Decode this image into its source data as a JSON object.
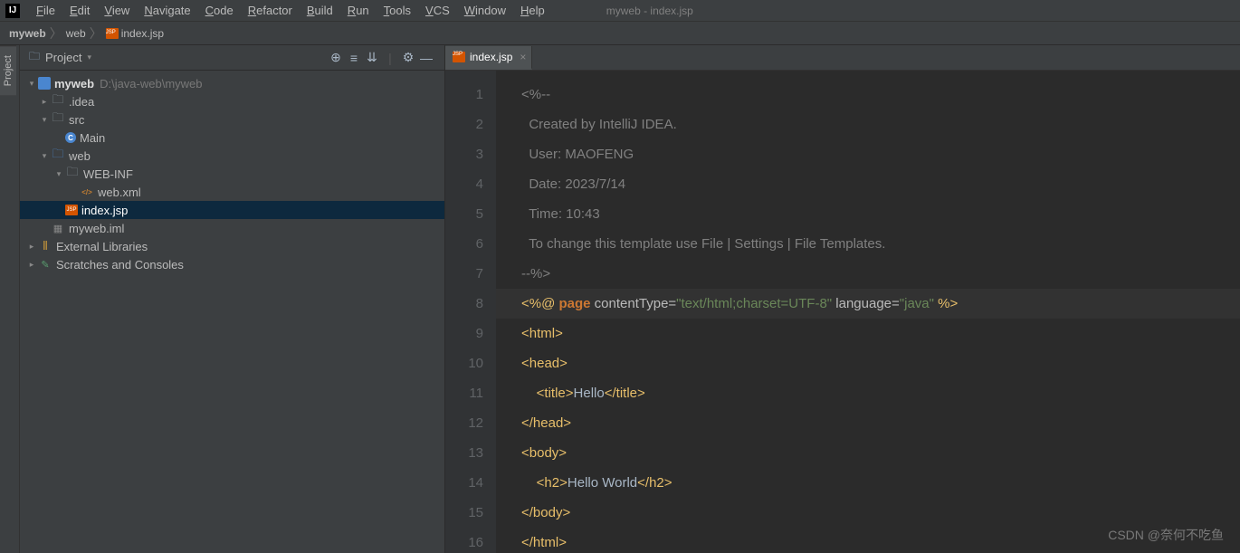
{
  "window": {
    "title": "myweb - index.jsp"
  },
  "menubar": [
    "File",
    "Edit",
    "View",
    "Navigate",
    "Code",
    "Refactor",
    "Build",
    "Run",
    "Tools",
    "VCS",
    "Window",
    "Help"
  ],
  "breadcrumbs": [
    {
      "label": "myweb",
      "bold": true
    },
    {
      "label": "web",
      "bold": false
    },
    {
      "label": "index.jsp",
      "bold": false,
      "icon": "jsp"
    }
  ],
  "project_pane": {
    "title": "Project",
    "tree": [
      {
        "depth": 0,
        "arrow": "down",
        "icon": "module",
        "label": "myweb",
        "suffix": "D:\\java-web\\myweb"
      },
      {
        "depth": 1,
        "arrow": "right",
        "icon": "folder",
        "label": ".idea"
      },
      {
        "depth": 1,
        "arrow": "down",
        "icon": "folder",
        "label": "src"
      },
      {
        "depth": 2,
        "arrow": "none",
        "icon": "class",
        "label": "Main"
      },
      {
        "depth": 1,
        "arrow": "down",
        "icon": "webfolder",
        "label": "web"
      },
      {
        "depth": 2,
        "arrow": "down",
        "icon": "folder",
        "label": "WEB-INF"
      },
      {
        "depth": 3,
        "arrow": "none",
        "icon": "xml",
        "label": "web.xml"
      },
      {
        "depth": 2,
        "arrow": "none",
        "icon": "jsp",
        "label": "index.jsp",
        "selected": true
      },
      {
        "depth": 1,
        "arrow": "none",
        "icon": "iml",
        "label": "myweb.iml"
      },
      {
        "depth": 0,
        "arrow": "right",
        "icon": "lib",
        "label": "External Libraries"
      },
      {
        "depth": 0,
        "arrow": "right",
        "icon": "scratch",
        "label": "Scratches and Consoles"
      }
    ]
  },
  "side_tab": "Project",
  "editor": {
    "tab": {
      "label": "index.jsp",
      "icon": "jsp"
    },
    "lines": [
      {
        "n": 1,
        "segments": [
          {
            "t": "<%--",
            "c": "comment"
          }
        ]
      },
      {
        "n": 2,
        "segments": [
          {
            "t": "  Created by IntelliJ IDEA.",
            "c": "comment"
          }
        ]
      },
      {
        "n": 3,
        "segments": [
          {
            "t": "  User: MAOFENG",
            "c": "comment"
          }
        ]
      },
      {
        "n": 4,
        "segments": [
          {
            "t": "  Date: 2023/7/14",
            "c": "comment"
          }
        ]
      },
      {
        "n": 5,
        "segments": [
          {
            "t": "  Time: 10:43",
            "c": "comment"
          }
        ]
      },
      {
        "n": 6,
        "segments": [
          {
            "t": "  To change this template use File | Settings | File Templates.",
            "c": "comment"
          }
        ]
      },
      {
        "n": 7,
        "segments": [
          {
            "t": "--%>",
            "c": "comment"
          }
        ]
      },
      {
        "n": 8,
        "hl": true,
        "segments": [
          {
            "t": "<%@ ",
            "c": "tag"
          },
          {
            "t": "page",
            "c": "kw"
          },
          {
            "t": " contentType=",
            "c": "attr"
          },
          {
            "t": "\"text/html;charset=UTF-8\"",
            "c": "str"
          },
          {
            "t": " language=",
            "c": "attr"
          },
          {
            "t": "\"java\"",
            "c": "str"
          },
          {
            "t": " %>",
            "c": "tag"
          }
        ]
      },
      {
        "n": 9,
        "segments": [
          {
            "t": "<html>",
            "c": "tag"
          }
        ]
      },
      {
        "n": 10,
        "segments": [
          {
            "t": "<head>",
            "c": "tag"
          }
        ]
      },
      {
        "n": 11,
        "segments": [
          {
            "t": "    ",
            "c": "text"
          },
          {
            "t": "<title>",
            "c": "tag"
          },
          {
            "t": "Hello",
            "c": "text"
          },
          {
            "t": "</title>",
            "c": "tag"
          }
        ]
      },
      {
        "n": 12,
        "segments": [
          {
            "t": "</head>",
            "c": "tag"
          }
        ]
      },
      {
        "n": 13,
        "segments": [
          {
            "t": "<body>",
            "c": "tag"
          }
        ]
      },
      {
        "n": 14,
        "segments": [
          {
            "t": "    ",
            "c": "text"
          },
          {
            "t": "<h2>",
            "c": "tag"
          },
          {
            "t": "Hello World",
            "c": "text"
          },
          {
            "t": "</h2>",
            "c": "tag"
          }
        ]
      },
      {
        "n": 15,
        "segments": [
          {
            "t": "</body>",
            "c": "tag"
          }
        ]
      },
      {
        "n": 16,
        "segments": [
          {
            "t": "</html>",
            "c": "tag"
          }
        ]
      }
    ]
  },
  "watermark": "CSDN @奈何不吃鱼"
}
